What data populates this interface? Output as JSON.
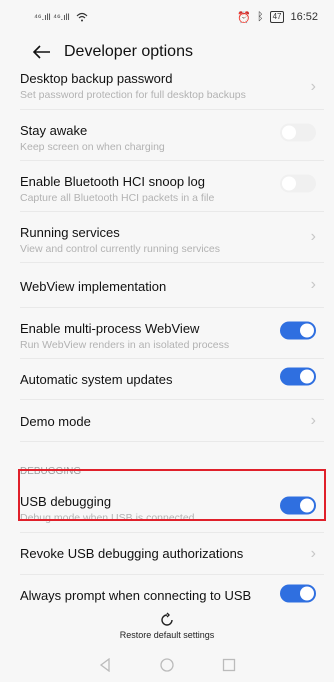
{
  "status_bar": {
    "left": "⁴⁶.ıll ⁴⁶.ıll",
    "battery": "47",
    "time": "16:52"
  },
  "header": {
    "title": "Developer options"
  },
  "items": [
    {
      "label": "Desktop backup password",
      "sub": "Set password protection for full desktop backups",
      "control": "chevron"
    },
    {
      "label": "Stay awake",
      "sub": "Keep screen on when charging",
      "control": "toggle-off"
    },
    {
      "label": "Enable Bluetooth HCI snoop log",
      "sub": "Capture all Bluetooth HCI packets in a file",
      "control": "toggle-off"
    },
    {
      "label": "Running services",
      "sub": "View and control currently running services",
      "control": "chevron"
    },
    {
      "label": "WebView implementation",
      "sub": "",
      "control": "chevron"
    },
    {
      "label": "Enable multi-process WebView",
      "sub": "Run WebView renders in an isolated process",
      "control": "toggle-on"
    },
    {
      "label": "Automatic system updates",
      "sub": "",
      "control": "toggle-on"
    },
    {
      "label": "Demo mode",
      "sub": "",
      "control": "chevron"
    }
  ],
  "section": {
    "debugging": "DEBUGGING"
  },
  "debug_items": [
    {
      "label": "USB debugging",
      "sub": "Debug mode when USB is connected",
      "control": "toggle-on"
    },
    {
      "label": "Revoke USB debugging authorizations",
      "sub": "",
      "control": "chevron"
    },
    {
      "label": "Always prompt when connecting to USB",
      "sub": "",
      "control": "toggle-on"
    }
  ],
  "footer": {
    "restore_label": "Restore default settings"
  },
  "colors": {
    "accent": "#2f6fe0",
    "highlight": "#e0202a"
  }
}
